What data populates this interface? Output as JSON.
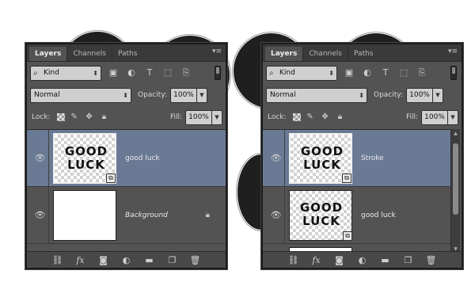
{
  "left": {
    "tabs": [
      "Layers",
      "Channels",
      "Paths"
    ],
    "panel_menu_icon": "menu-lines-icon",
    "filter": {
      "kind_label": "Kind"
    },
    "blend_mode": "Normal",
    "opacity_label": "Opacity:",
    "opacity_value": "100%",
    "lock_label": "Lock:",
    "fill_label": "Fill:",
    "fill_value": "100%",
    "layers": [
      {
        "name": "good luck",
        "thumb_text": "GOOD LUCK",
        "selected": true
      },
      {
        "name": "Background",
        "thumb_text": "",
        "selected": false
      }
    ]
  },
  "right": {
    "tabs": [
      "Layers",
      "Channels",
      "Paths"
    ],
    "panel_menu_icon": "menu-lines-icon",
    "filter": {
      "kind_label": "Kind"
    },
    "blend_mode": "Normal",
    "opacity_label": "Opacity:",
    "opacity_value": "100%",
    "lock_label": "Lock:",
    "fill_label": "Fill:",
    "fill_value": "100%",
    "layers": [
      {
        "name": "Stroke",
        "thumb_text": "GOOD LUCK",
        "selected": true
      },
      {
        "name": "good luck",
        "thumb_text": "GOOD LUCK",
        "selected": false
      }
    ]
  },
  "colors": {
    "panel_bg": "#535353",
    "selected_row": "#6a7a95",
    "circle_fill": "#1f1f1f"
  }
}
